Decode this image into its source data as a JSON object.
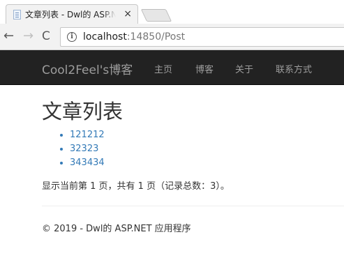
{
  "browser": {
    "tab_title": "文章列表 - Dwl的 ASP.NET",
    "tab_close": "×",
    "back_glyph": "←",
    "forward_glyph": "→",
    "reload_glyph": "C",
    "url_host": "localhost",
    "url_rest": ":14850/Post",
    "info_glyph": "i"
  },
  "navbar": {
    "brand": "Cool2Feel's博客",
    "links": [
      "主页",
      "博客",
      "关于",
      "联系方式"
    ]
  },
  "main": {
    "title": "文章列表",
    "posts": [
      "121212",
      "32323",
      "343434"
    ],
    "pager": "显示当前第 1 页，共有 1 页（记录总数：3）。"
  },
  "footer": {
    "text": "© 2019 - Dwl的 ASP.NET 应用程序"
  },
  "colors": {
    "navbar_bg": "#222222",
    "navbar_text": "#9d9d9d",
    "link": "#337ab7"
  }
}
